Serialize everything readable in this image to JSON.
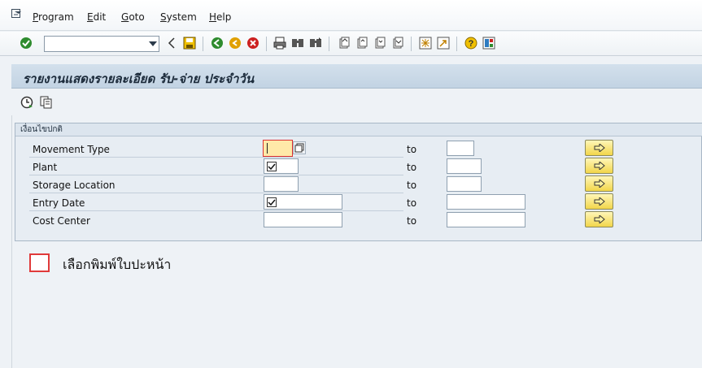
{
  "menubar": {
    "items": [
      {
        "label": "Program",
        "accel": "P"
      },
      {
        "label": "Edit",
        "accel": "E"
      },
      {
        "label": "Goto",
        "accel": "G"
      },
      {
        "label": "System",
        "accel": "S"
      },
      {
        "label": "Help",
        "accel": "H"
      }
    ]
  },
  "toolbar": {
    "command_value": "",
    "icons": [
      "enter-icon",
      "back-icon",
      "save-icon",
      "back-green-icon",
      "exit-icon",
      "cancel-icon",
      "print-icon",
      "find-icon",
      "find-next-icon",
      "first-page-icon",
      "previous-page-icon",
      "next-page-icon",
      "last-page-icon",
      "new-session-icon",
      "shortcut-icon",
      "help-icon",
      "layout-icon"
    ]
  },
  "title": "รายงานแสดงรายละเอียด รับ-จ่าย ประจำวัน",
  "app_toolbar": {
    "icons": [
      "execute-icon",
      "get-variant-icon"
    ]
  },
  "selection": {
    "group_title": "เงื่อนไขปกติ",
    "to_label": "to",
    "rows": [
      {
        "label": "Movement Type",
        "low": "",
        "high": "",
        "required": true
      },
      {
        "label": "Plant",
        "low": "",
        "high": "",
        "low_checked": true
      },
      {
        "label": "Storage Location",
        "low": "",
        "high": ""
      },
      {
        "label": "Entry Date",
        "low": "",
        "high": "",
        "low_checked": true
      },
      {
        "label": "Cost Center",
        "low": "",
        "high": ""
      }
    ]
  },
  "print_option": {
    "label": "เลือกพิมพ์ใบปะหน้า",
    "checked": false
  },
  "colors": {
    "required_field": "#ffe9a8",
    "required_border": "#dd3333",
    "arrow_button": "#f2d64a",
    "title_bar": "#c2d3e3"
  }
}
